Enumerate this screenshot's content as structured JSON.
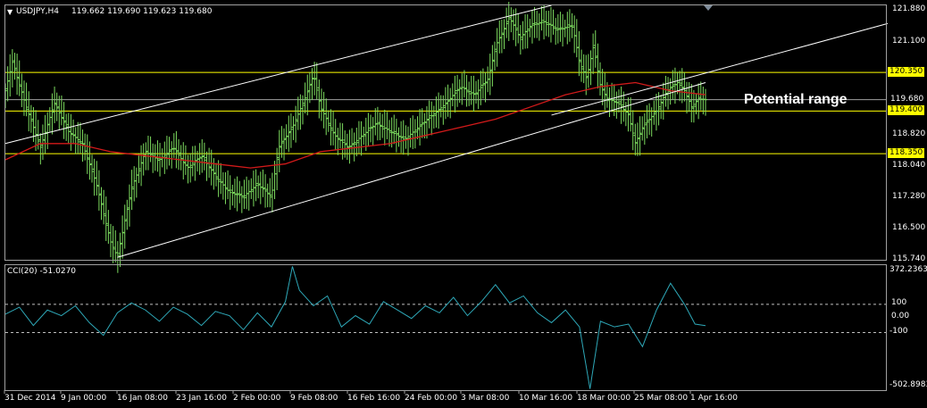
{
  "header": {
    "menu_icon": "triangle-down-icon",
    "symbol": "USDJPY,H4",
    "ohlc": "119.662 119.690 119.623 119.680"
  },
  "indicator": {
    "title": "CCI(20) -51.0270",
    "max_label": "372.2363",
    "min_label": "-502.8983",
    "levels": [
      "100",
      "0.00",
      "-100"
    ]
  },
  "annotation": "Potential range",
  "colors": {
    "background": "#000000",
    "bars": "#7ddc5f",
    "ma": "#d31a1a",
    "channel": "#ffffff",
    "levels": "#ffff00",
    "cci": "#2ea8b8"
  },
  "chart_data": [
    {
      "type": "line",
      "name": "price",
      "x_ticks": [
        "31 Dec 2014",
        "9 Jan 00:00",
        "16 Jan 08:00",
        "23 Jan 16:00",
        "2 Feb 00:00",
        "9 Feb 08:00",
        "16 Feb 16:00",
        "24 Feb 00:00",
        "3 Mar 08:00",
        "10 Mar 16:00",
        "18 Mar 00:00",
        "25 Mar 08:00",
        "1 Apr 16:00"
      ],
      "y_ticks": [
        "121.880",
        "121.100",
        "120.350",
        "119.680",
        "119.400",
        "118.820",
        "118.350",
        "118.040",
        "117.280",
        "116.500",
        "115.740"
      ],
      "ylim": [
        115.74,
        122.0
      ],
      "price_path": [
        [
          0,
          119.9
        ],
        [
          0.01,
          120.6
        ],
        [
          0.03,
          119.5
        ],
        [
          0.05,
          118.5
        ],
        [
          0.07,
          119.6
        ],
        [
          0.09,
          118.9
        ],
        [
          0.11,
          118.6
        ],
        [
          0.13,
          117.6
        ],
        [
          0.15,
          116.2
        ],
        [
          0.16,
          115.8
        ],
        [
          0.18,
          117.5
        ],
        [
          0.2,
          118.4
        ],
        [
          0.22,
          118.2
        ],
        [
          0.24,
          118.5
        ],
        [
          0.26,
          118.0
        ],
        [
          0.28,
          118.3
        ],
        [
          0.3,
          117.8
        ],
        [
          0.32,
          117.4
        ],
        [
          0.34,
          117.3
        ],
        [
          0.36,
          117.6
        ],
        [
          0.38,
          117.3
        ],
        [
          0.39,
          118.5
        ],
        [
          0.41,
          119.0
        ],
        [
          0.43,
          119.8
        ],
        [
          0.44,
          120.3
        ],
        [
          0.45,
          119.5
        ],
        [
          0.47,
          118.8
        ],
        [
          0.49,
          118.5
        ],
        [
          0.51,
          118.8
        ],
        [
          0.53,
          119.1
        ],
        [
          0.55,
          118.9
        ],
        [
          0.57,
          118.7
        ],
        [
          0.59,
          119.0
        ],
        [
          0.61,
          119.3
        ],
        [
          0.63,
          119.6
        ],
        [
          0.65,
          120.0
        ],
        [
          0.67,
          119.8
        ],
        [
          0.69,
          120.2
        ],
        [
          0.7,
          121.0
        ],
        [
          0.72,
          121.7
        ],
        [
          0.735,
          121.2
        ],
        [
          0.75,
          121.5
        ],
        [
          0.77,
          121.6
        ],
        [
          0.79,
          121.4
        ],
        [
          0.81,
          121.5
        ],
        [
          0.82,
          120.6
        ],
        [
          0.83,
          120.2
        ],
        [
          0.84,
          121.0
        ],
        [
          0.85,
          120.0
        ],
        [
          0.86,
          119.7
        ],
        [
          0.875,
          119.6
        ],
        [
          0.89,
          119.3
        ],
        [
          0.9,
          118.6
        ],
        [
          0.91,
          119.0
        ],
        [
          0.93,
          119.4
        ],
        [
          0.945,
          119.9
        ],
        [
          0.96,
          120.1
        ],
        [
          0.97,
          119.9
        ],
        [
          0.98,
          119.5
        ],
        [
          0.99,
          119.7
        ],
        [
          1.0,
          119.68
        ]
      ],
      "ma_path": [
        [
          0,
          118.2
        ],
        [
          0.05,
          118.6
        ],
        [
          0.1,
          118.6
        ],
        [
          0.15,
          118.4
        ],
        [
          0.2,
          118.3
        ],
        [
          0.25,
          118.2
        ],
        [
          0.3,
          118.1
        ],
        [
          0.35,
          118.0
        ],
        [
          0.4,
          118.1
        ],
        [
          0.45,
          118.4
        ],
        [
          0.5,
          118.5
        ],
        [
          0.55,
          118.6
        ],
        [
          0.6,
          118.8
        ],
        [
          0.65,
          119.0
        ],
        [
          0.7,
          119.2
        ],
        [
          0.75,
          119.5
        ],
        [
          0.8,
          119.8
        ],
        [
          0.85,
          120.0
        ],
        [
          0.9,
          120.1
        ],
        [
          0.95,
          119.9
        ],
        [
          1.0,
          119.8
        ]
      ],
      "channel_upper": [
        [
          0.0,
          118.6
        ],
        [
          0.78,
          122.0
        ]
      ],
      "channel_lower": [
        [
          0.16,
          115.8
        ],
        [
          1.0,
          120.1
        ]
      ],
      "channel_lower_ext": [
        [
          0.78,
          119.3
        ],
        [
          1.27,
          121.6
        ]
      ],
      "horizontal_levels": [
        {
          "value": 120.35,
          "label": "120.350",
          "color": "#ffff00",
          "highlight": true
        },
        {
          "value": 119.68,
          "label": "119.680",
          "color": "#a0a0a0",
          "highlight": false
        },
        {
          "value": 119.4,
          "label": "119.400",
          "color": "#ffff00",
          "highlight": true
        },
        {
          "value": 118.35,
          "label": "118.350",
          "color": "#ffff00",
          "highlight": true
        }
      ]
    },
    {
      "type": "line",
      "name": "CCI(20)",
      "ylim": [
        -502.8983,
        372.2363
      ],
      "levels": [
        100,
        0,
        -100
      ],
      "cci_path": [
        [
          0,
          30
        ],
        [
          0.02,
          80
        ],
        [
          0.04,
          -50
        ],
        [
          0.06,
          60
        ],
        [
          0.08,
          20
        ],
        [
          0.1,
          90
        ],
        [
          0.12,
          -30
        ],
        [
          0.14,
          -120
        ],
        [
          0.16,
          40
        ],
        [
          0.18,
          110
        ],
        [
          0.2,
          60
        ],
        [
          0.22,
          -20
        ],
        [
          0.24,
          80
        ],
        [
          0.26,
          30
        ],
        [
          0.28,
          -50
        ],
        [
          0.3,
          50
        ],
        [
          0.32,
          20
        ],
        [
          0.34,
          -80
        ],
        [
          0.36,
          40
        ],
        [
          0.38,
          -60
        ],
        [
          0.4,
          120
        ],
        [
          0.41,
          370
        ],
        [
          0.42,
          200
        ],
        [
          0.44,
          90
        ],
        [
          0.46,
          160
        ],
        [
          0.48,
          -60
        ],
        [
          0.5,
          20
        ],
        [
          0.52,
          -40
        ],
        [
          0.54,
          120
        ],
        [
          0.56,
          60
        ],
        [
          0.58,
          0
        ],
        [
          0.6,
          90
        ],
        [
          0.62,
          40
        ],
        [
          0.64,
          150
        ],
        [
          0.66,
          20
        ],
        [
          0.68,
          120
        ],
        [
          0.7,
          240
        ],
        [
          0.72,
          110
        ],
        [
          0.74,
          160
        ],
        [
          0.76,
          40
        ],
        [
          0.78,
          -30
        ],
        [
          0.8,
          60
        ],
        [
          0.82,
          -60
        ],
        [
          0.835,
          -500
        ],
        [
          0.85,
          -20
        ],
        [
          0.87,
          -60
        ],
        [
          0.89,
          -40
        ],
        [
          0.91,
          -200
        ],
        [
          0.93,
          60
        ],
        [
          0.95,
          250
        ],
        [
          0.97,
          100
        ],
        [
          0.985,
          -40
        ],
        [
          1.0,
          -51.03
        ]
      ]
    }
  ]
}
